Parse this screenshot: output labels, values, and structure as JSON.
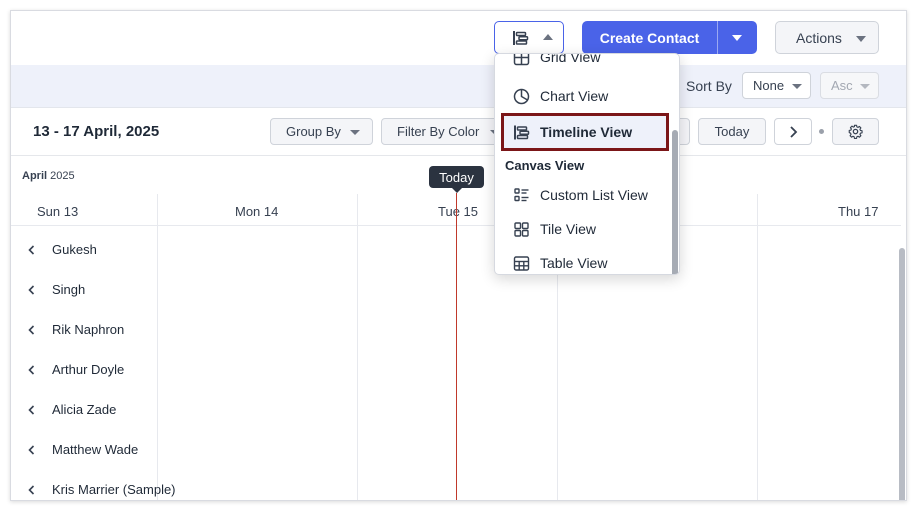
{
  "header": {
    "create_label": "Create Contact",
    "actions_label": "Actions"
  },
  "sortbar": {
    "sort_label": "Sort By",
    "sort_value": "None",
    "order_value": "Asc"
  },
  "toolbar": {
    "date_range": "13 - 17 April, 2025",
    "group_by": "Group By",
    "filter_by_color": "Filter By Color",
    "today": "Today"
  },
  "timeline": {
    "month": "April",
    "year": "2025",
    "today_tag": "Today",
    "days": [
      "Sun 13",
      "Mon 14",
      "Tue 15",
      "Thu 17"
    ],
    "rows": [
      "Gukesh",
      "Singh",
      "Rik Naphron",
      "Arthur Doyle",
      "Alicia Zade",
      "Matthew Wade",
      "Kris Marrier (Sample)"
    ]
  },
  "view_menu": {
    "partial_item": "Grid View",
    "chart_view": "Chart View",
    "timeline_view": "Timeline View",
    "section_canvas": "Canvas View",
    "custom_list_view": "Custom List View",
    "tile_view": "Tile View",
    "table_view": "Table View"
  },
  "colors": {
    "accent": "#4a63e8",
    "highlight_border": "#7b1618",
    "today_line": "#c0392b"
  }
}
